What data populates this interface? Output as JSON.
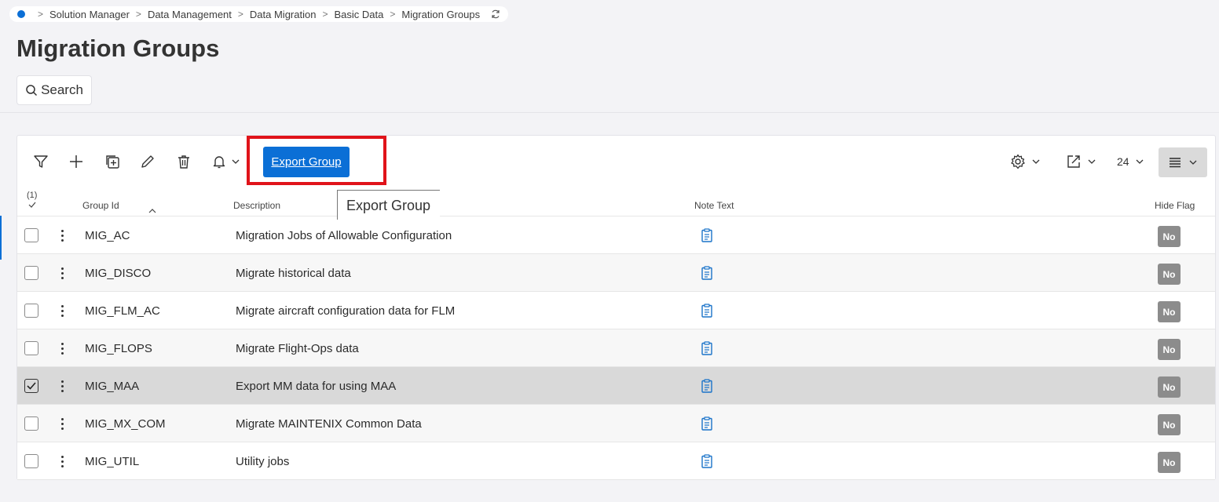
{
  "breadcrumb": {
    "items": [
      "Solution Manager",
      "Data Management",
      "Data Migration",
      "Basic Data",
      "Migration Groups"
    ]
  },
  "page": {
    "title": "Migration Groups"
  },
  "search": {
    "label": "Search"
  },
  "toolbar": {
    "icons": [
      "filter-icon",
      "add-icon",
      "duplicate-icon",
      "edit-icon",
      "delete-icon",
      "bell-icon"
    ],
    "export_label": "Export Group",
    "tooltip": "Export Group",
    "page_size": "24"
  },
  "table": {
    "selected_count": "(1)",
    "columns": {
      "group_id": "Group Id",
      "description": "Description",
      "note_text": "Note Text",
      "hide_flag": "Hide Flag"
    },
    "rows": [
      {
        "group_id": "MIG_AC",
        "description": "Migration Jobs of Allowable Configuration",
        "hide_flag": "No",
        "checked": false
      },
      {
        "group_id": "MIG_DISCO",
        "description": "Migrate historical data",
        "hide_flag": "No",
        "checked": false
      },
      {
        "group_id": "MIG_FLM_AC",
        "description": "Migrate aircraft configuration data for FLM",
        "hide_flag": "No",
        "checked": false
      },
      {
        "group_id": "MIG_FLOPS",
        "description": "Migrate Flight-Ops data",
        "hide_flag": "No",
        "checked": false
      },
      {
        "group_id": "MIG_MAA",
        "description": "Export MM data for using MAA",
        "hide_flag": "No",
        "checked": true
      },
      {
        "group_id": "MIG_MX_COM",
        "description": "Migrate MAINTENIX Common Data",
        "hide_flag": "No",
        "checked": false
      },
      {
        "group_id": "MIG_UTIL",
        "description": "Utility jobs",
        "hide_flag": "No",
        "checked": false
      }
    ]
  },
  "colors": {
    "accent": "#0b6fd6",
    "highlight": "#e0131a",
    "badge": "#8c8c8c",
    "selected_row": "#d9d9d9"
  }
}
